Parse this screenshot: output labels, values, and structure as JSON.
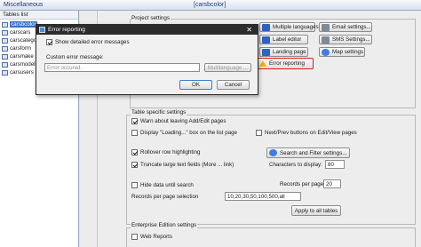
{
  "topbar": {
    "menu": "Miscellaneous",
    "title": "[carsbcolor]"
  },
  "tables": {
    "header": "Tables list",
    "items": [
      "carsbcolor",
      "carscars",
      "carscategory",
      "carsform",
      "carsmake",
      "carsmodels",
      "carsusers"
    ]
  },
  "project": {
    "label": "Project settings",
    "buttons": {
      "multiple_languages": "Multiple languages",
      "email_settings": "Email settings...",
      "label_editor": "Label editor",
      "sms_settings": "SMS Settings...",
      "landing_page": "Landing page",
      "map_settings": "Map settings",
      "error_reporting": "Error reporting"
    }
  },
  "table_settings": {
    "label": "Table specific settings",
    "warn_leaving": "Warn about leaving Add/Edit pages",
    "display_loading": "Display \"Loading...\" box on the list page",
    "next_prev": "Next/Prev buttons on Edit/View pages",
    "rollover": "Rollover row highlighting",
    "search_filter": "Search and Filter settings...",
    "truncate": "Truncate large text fields (More ... link)",
    "chars_label": "Characters to display:",
    "chars_value": "80",
    "hide_data": "Hide data until search",
    "records_label": "Records per page",
    "records_value": "20",
    "records_selection_label": "Records per page selection",
    "records_selection_value": "10,20,30,50,100,500,all",
    "apply_all": "Apply to all tables"
  },
  "enterprise": {
    "label": "Enterprise Edition settings",
    "web_reports": "Web Reports"
  },
  "dialog": {
    "title": "Error reporting",
    "close_glyph": "✕",
    "show_detailed": "Show detailed error messages",
    "custom_label": "Custom error message:",
    "custom_value": "Error occured.",
    "multilanguage": "Multilanguage ...",
    "ok": "OK",
    "cancel": "Cancel"
  }
}
